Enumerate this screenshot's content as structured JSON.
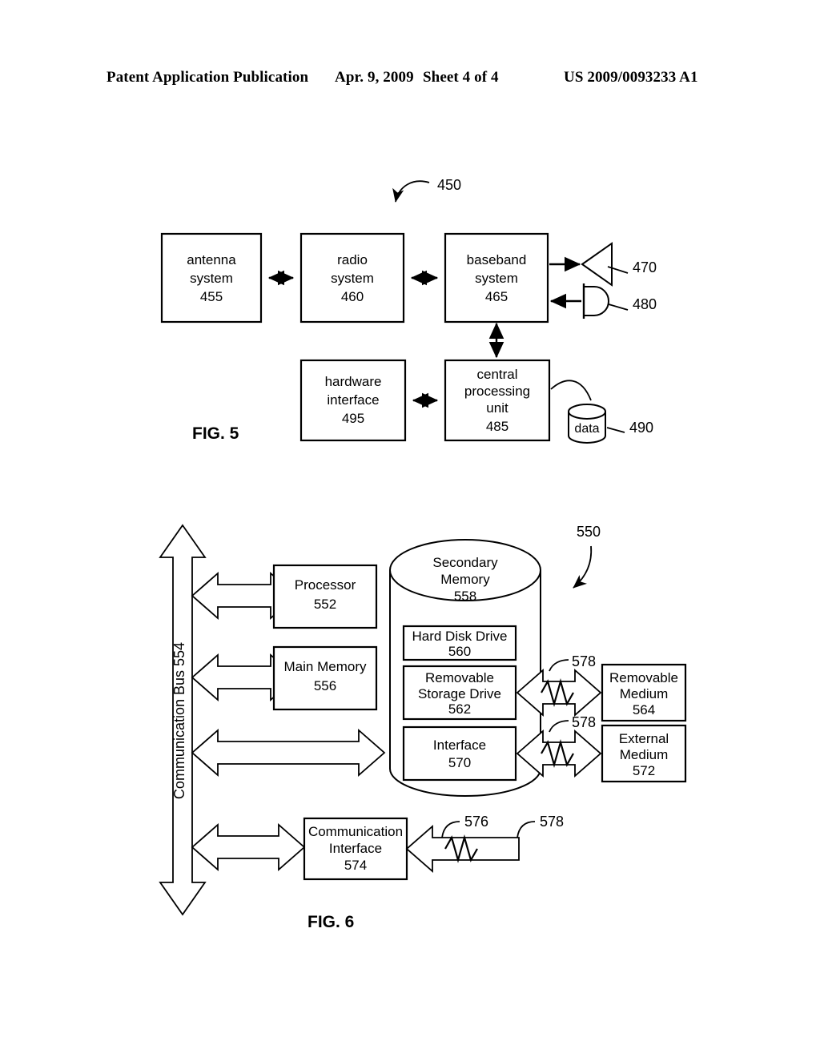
{
  "header": {
    "publication": "Patent Application Publication",
    "date": "Apr. 9, 2009",
    "sheet": "Sheet 4 of 4",
    "patent_number": "US 2009/0093233 A1"
  },
  "figure5": {
    "caption": "FIG. 5",
    "reference": "450",
    "blocks": {
      "antenna": {
        "line1": "antenna",
        "line2": "system",
        "ref": "455"
      },
      "radio": {
        "line1": "radio",
        "line2": "system",
        "ref": "460"
      },
      "baseband": {
        "line1": "baseband",
        "line2": "system",
        "ref": "465"
      },
      "hardware": {
        "line1": "hardware",
        "line2": "interface",
        "ref": "495"
      },
      "cpu": {
        "line1": "central",
        "line2": "processing",
        "line3": "unit",
        "ref": "485"
      }
    },
    "peripherals": {
      "speaker_ref": "470",
      "microphone_ref": "480",
      "data_store_label": "data",
      "data_store_ref": "490"
    }
  },
  "figure6": {
    "caption": "FIG. 6",
    "reference": "550",
    "bus": {
      "label": "Communication Bus 554"
    },
    "blocks": {
      "processor": {
        "line1": "Processor",
        "ref": "552"
      },
      "main_memory": {
        "line1": "Main Memory",
        "ref": "556"
      },
      "secondary_memory": {
        "line1": "Secondary",
        "line2": "Memory",
        "ref": "558"
      },
      "hard_disk_drive": {
        "line1": "Hard Disk Drive",
        "ref": "560"
      },
      "removable_storage_drive": {
        "line1": "Removable",
        "line2": "Storage Drive",
        "ref": "562"
      },
      "interface": {
        "line1": "Interface",
        "ref": "570"
      },
      "removable_medium": {
        "line1": "Removable",
        "line2": "Medium",
        "ref": "564"
      },
      "external_medium": {
        "line1": "External",
        "line2": "Medium",
        "ref": "572"
      },
      "communication_interface": {
        "line1": "Communication",
        "line2": "Interface",
        "ref": "574"
      }
    },
    "signal_refs": {
      "removable_path": "578",
      "external_path": "578",
      "comm_channel": "576",
      "comm_signal": "578"
    }
  }
}
